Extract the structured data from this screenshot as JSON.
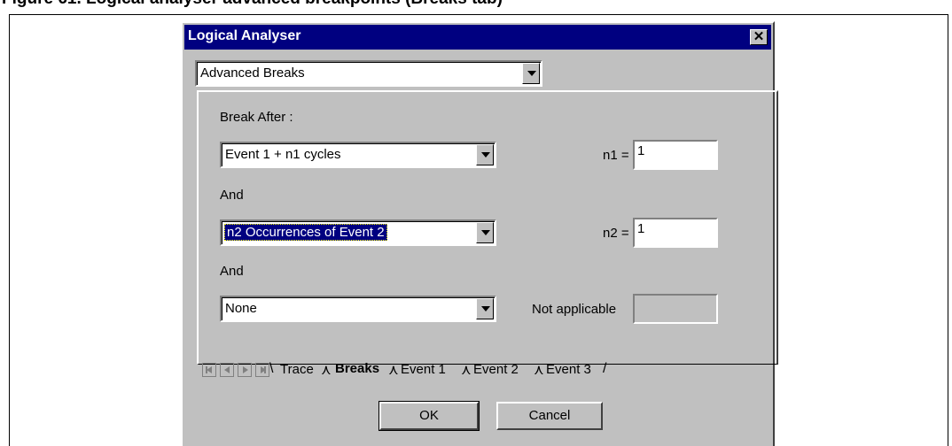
{
  "caption": "Figure 61. Logical analyser advanced breakpoints (Breaks tab)",
  "window": {
    "title": "Logical Analyser",
    "close_glyph": "✕"
  },
  "mode_select": {
    "value": "Advanced Breaks"
  },
  "breaks": {
    "break_after_label": "Break After :",
    "and_label_1": "And",
    "and_label_2": "And",
    "condition_1": {
      "value": "Event 1 + n1 cycles"
    },
    "condition_2": {
      "value": "n2 Occurrences of Event 2"
    },
    "condition_3": {
      "value": "None"
    },
    "n1": {
      "label": "n1 =",
      "value": "1"
    },
    "n2": {
      "label": "n2 =",
      "value": "1"
    },
    "third": {
      "label": "Not applicable",
      "value": ""
    }
  },
  "tabs": [
    "Trace",
    "Breaks",
    "Event 1",
    "Event 2",
    "Event 3"
  ],
  "active_tab": "Breaks",
  "buttons": {
    "ok": "OK",
    "cancel": "Cancel"
  }
}
